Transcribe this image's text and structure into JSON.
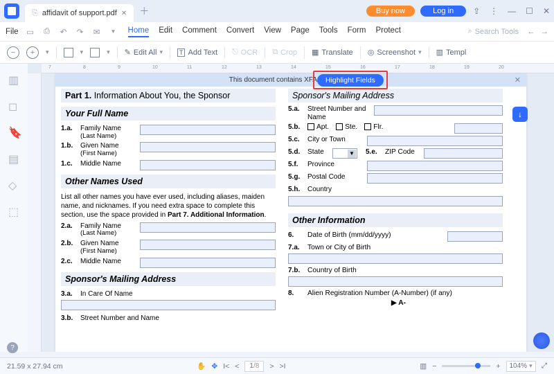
{
  "titlebar": {
    "tab": "affidavit of support.pdf",
    "buy": "Buy now",
    "login": "Log in"
  },
  "menubar": {
    "file": "File",
    "tabs": [
      "Home",
      "Edit",
      "Comment",
      "Convert",
      "View",
      "Page",
      "Tools",
      "Form",
      "Protect"
    ],
    "search_ph": "Search Tools"
  },
  "toolbar": {
    "edit_all": "Edit All",
    "add_text": "Add Text",
    "ocr": "OCR",
    "crop": "Crop",
    "translate": "Translate",
    "screenshot": "Screenshot",
    "templ": "Templ"
  },
  "ruler_ticks": [
    "7",
    "8",
    "9",
    "10",
    "11",
    "12",
    "13",
    "14",
    "15",
    "16",
    "17",
    "18",
    "19",
    "20"
  ],
  "banner": {
    "msg": "This document contains XFA form fields.",
    "btn": "Highlight Fields"
  },
  "doc": {
    "part_head_pre": "Part 1.",
    "part_head_txt": "Information About You, the Sponsor",
    "part_head_txt2": "Sponsor's Mailing Address",
    "sec_fullname": "Your Full Name",
    "r1a": {
      "n": "1.a.",
      "l": "Family Name",
      "s": "(Last Name)"
    },
    "r1b": {
      "n": "1.b.",
      "l": "Given Name",
      "s": "(First Name)"
    },
    "r1c": {
      "n": "1.c.",
      "l": "Middle Name"
    },
    "sec_other": "Other Names Used",
    "other_p1": "List all other names you have ever used, including aliases, maiden name, and nicknames.  If you need extra space to complete this section, use the space provided in ",
    "other_p2": "Part 7. Additional Information",
    "r2a": {
      "n": "2.a.",
      "l": "Family Name",
      "s": "(Last Name)"
    },
    "r2b": {
      "n": "2.b.",
      "l": "Given Name",
      "s": "(First Name)"
    },
    "r2c": {
      "n": "2.c.",
      "l": "Middle Name"
    },
    "sec_addr": "Sponsor's Mailing Address",
    "r3a": {
      "n": "3.a.",
      "l": "In Care Of Name"
    },
    "r3b": {
      "n": "3.b.",
      "l": "Street Number and Name"
    },
    "r5a": {
      "n": "5.a.",
      "l": "Street Number and Name"
    },
    "r5b": {
      "n": "5.b.",
      "apt": "Apt.",
      "ste": "Ste.",
      "flr": "Flr."
    },
    "r5c": {
      "n": "5.c.",
      "l": "City or Town"
    },
    "r5d": {
      "n": "5.d.",
      "l": "State"
    },
    "r5dz": {
      "n": "5.e.",
      "l": "ZIP Code"
    },
    "r5f": {
      "n": "5.f.",
      "l": "Province"
    },
    "r5g": {
      "n": "5.g.",
      "l": "Postal Code"
    },
    "r5h": {
      "n": "5.h.",
      "l": "Country"
    },
    "sec_info": "Other Information",
    "r6": {
      "n": "6.",
      "l": "Date of Birth (mm/dd/yyyy)"
    },
    "r7a": {
      "n": "7.a.",
      "l": "Town or City of Birth"
    },
    "r7b": {
      "n": "7.b.",
      "l": "Country of Birth"
    },
    "r8": {
      "n": "8.",
      "l": "Alien Registration Number (A-Number) (if any)"
    },
    "r8a": "A-"
  },
  "status": {
    "dim": "21.59 x 27.94 cm",
    "page": "1",
    "pages": "/8",
    "zoom": "104%"
  }
}
